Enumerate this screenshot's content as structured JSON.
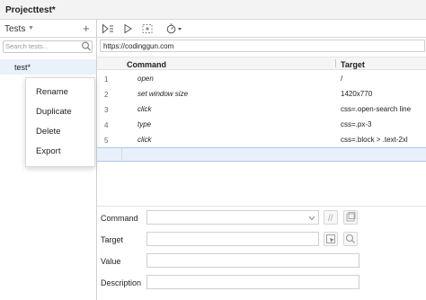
{
  "header": {
    "project_label": "Project:",
    "project_name": "test*"
  },
  "sidebar": {
    "tests_dropdown": "Tests",
    "add_label": "+",
    "search_placeholder": "Search tests...",
    "items": [
      {
        "label": "test*",
        "selected": true
      }
    ]
  },
  "context_menu": {
    "items": [
      "Rename",
      "Duplicate",
      "Delete",
      "Export"
    ]
  },
  "toolbar": {
    "icons": [
      "run-all-icon",
      "run-icon",
      "record-icon",
      "speed-icon"
    ]
  },
  "url_bar": {
    "value": "https://codinggun.com"
  },
  "table": {
    "columns": [
      "Command",
      "Target"
    ],
    "rows": [
      {
        "num": "1",
        "command": "open",
        "target": "/"
      },
      {
        "num": "2",
        "command": "set window size",
        "target": "1420x770"
      },
      {
        "num": "3",
        "command": "click",
        "target": "css=.open-search line"
      },
      {
        "num": "4",
        "command": "type",
        "target": "css=.px-3"
      },
      {
        "num": "5",
        "command": "click",
        "target": "css=.block > .text-2xl"
      }
    ]
  },
  "form": {
    "command_label": "Command",
    "target_label": "Target",
    "value_label": "Value",
    "description_label": "Description",
    "command_value": "",
    "target_value": "",
    "value_value": "",
    "description_value": ""
  },
  "colors": {
    "selection": "#e8f1fb",
    "selection_border": "#a8c6ea",
    "header_bg": "#f5f5f5"
  }
}
